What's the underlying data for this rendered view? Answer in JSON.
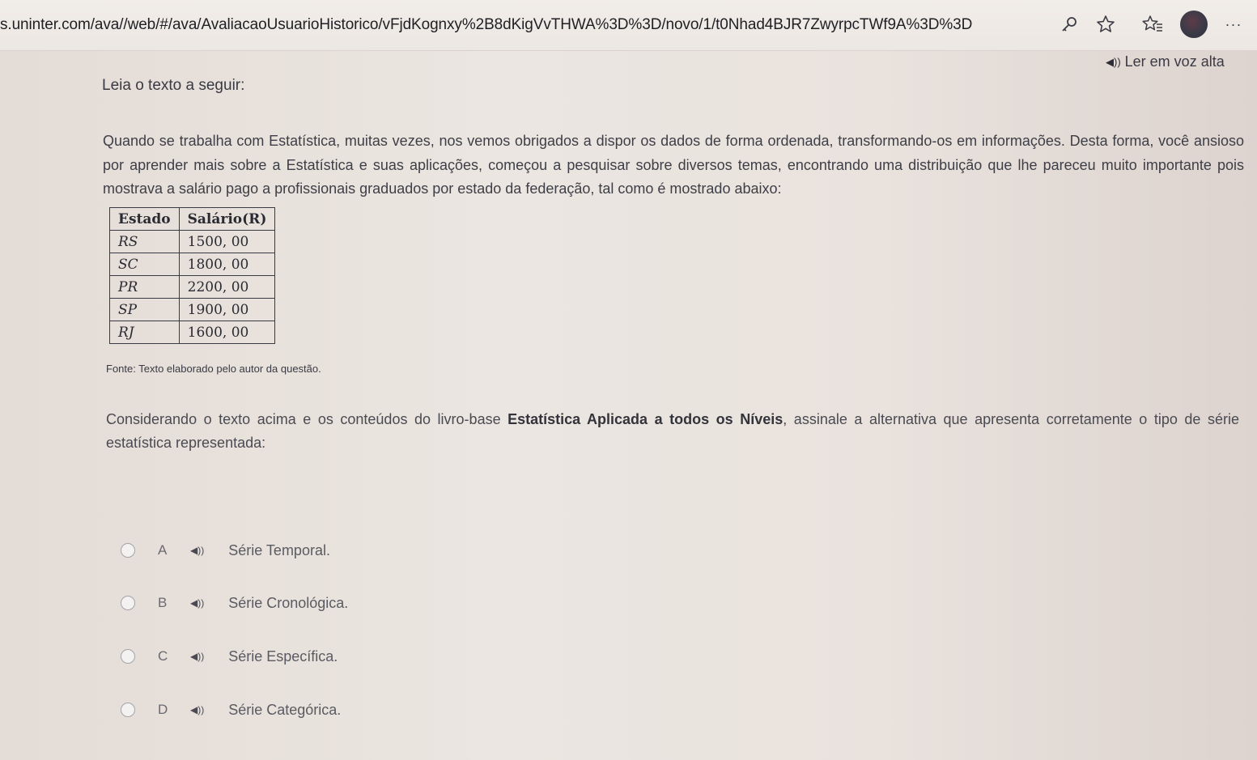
{
  "browser": {
    "url": "s.uninter.com/ava//web/#/ava/AvaliacaoUsuarioHistorico/vFjdKognxy%2B8dKigVvTHWA%3D%3D/novo/1/t0Nhad4BJR7ZwyrpcTWf9A%3D%3D",
    "icons": [
      "key-icon",
      "star-icon",
      "favorites-icon",
      "profile-avatar",
      "more-icon"
    ],
    "more_glyph": "···"
  },
  "read_aloud": {
    "label": "Ler em voz alta",
    "icon": "speaker-icon"
  },
  "intro": "Leia o texto a seguir:",
  "paragraph": "Quando se trabalha com Estatística, muitas vezes, nos vemos obrigados a dispor os dados de forma ordenada, transformando-os em informações. Desta forma, você ansioso por aprender mais sobre a Estatística e suas aplicações, começou a pesquisar sobre diversos temas, encontrando uma distribuição que lhe pareceu muito importante pois mostrava a salário pago a profissionais graduados por estado da federação, tal como é mostrado abaixo:",
  "table": {
    "headers": [
      "Estado",
      "Salário(R)"
    ],
    "rows": [
      [
        "RS",
        "1500, 00"
      ],
      [
        "SC",
        "1800, 00"
      ],
      [
        "PR",
        "2200, 00"
      ],
      [
        "SP",
        "1900, 00"
      ],
      [
        "RJ",
        "1600, 00"
      ]
    ]
  },
  "source": "Fonte: Texto elaborado pelo autor da questão.",
  "question": {
    "before": "Considerando o texto acima e os conteúdos do livro-base ",
    "book": "Estatística Aplicada a todos os Níveis",
    "after": ", assinale a alternativa que apresenta corretamente o tipo de série estatística representada:"
  },
  "options": [
    {
      "letter": "A",
      "text": "Série Temporal."
    },
    {
      "letter": "B",
      "text": "Série Cronológica."
    },
    {
      "letter": "C",
      "text": "Série Específica."
    },
    {
      "letter": "D",
      "text": "Série Categórica."
    }
  ],
  "colors": {
    "text": "#3e3e47",
    "background": "#e9e2dd",
    "radio_border": "#a3a3aa"
  }
}
